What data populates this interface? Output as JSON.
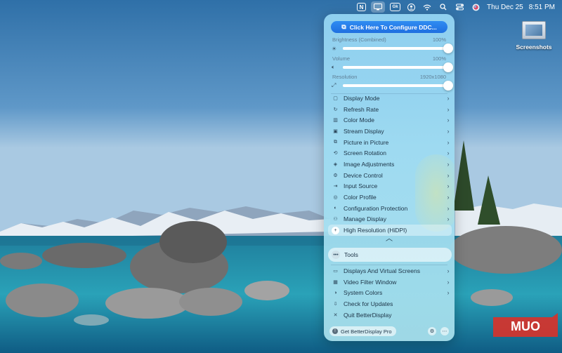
{
  "menubar": {
    "icons": [
      "notion-icon",
      "display-icon",
      "text-icon",
      "account-icon",
      "wifi-icon",
      "search-icon",
      "control-center-icon",
      "siri-icon"
    ],
    "notion_letter": "N",
    "text_icon_label": "Gk",
    "date": "Thu Dec 25",
    "time": "8:51 PM"
  },
  "desktop": {
    "icon_label": "Screenshots"
  },
  "panel": {
    "configure_button": "Click Here To Configure DDC...",
    "sliders": [
      {
        "label": "Brightness (Combined)",
        "value_text": "100%",
        "value": 1.0,
        "icon": "sun-icon"
      },
      {
        "label": "Volume",
        "value_text": "100%",
        "value": 1.0,
        "icon": "speaker-icon"
      },
      {
        "label": "Resolution",
        "value_text": "1920x1080",
        "value": 1.0,
        "icon": "resolution-icon"
      }
    ],
    "menu_items": [
      {
        "label": "Display Mode",
        "icon": "display-mode-icon",
        "submenu": true
      },
      {
        "label": "Refresh Rate",
        "icon": "refresh-rate-icon",
        "submenu": true
      },
      {
        "label": "Color Mode",
        "icon": "color-mode-icon",
        "submenu": true
      },
      {
        "label": "Stream Display",
        "icon": "stream-display-icon",
        "submenu": true
      },
      {
        "label": "Picture in Picture",
        "icon": "picture-in-picture-icon",
        "submenu": true
      },
      {
        "label": "Screen Rotation",
        "icon": "screen-rotation-icon",
        "submenu": true
      },
      {
        "label": "Image Adjustments",
        "icon": "image-adjustments-icon",
        "submenu": true
      },
      {
        "label": "Device Control",
        "icon": "device-control-icon",
        "submenu": true
      },
      {
        "label": "Input Source",
        "icon": "input-source-icon",
        "submenu": true
      },
      {
        "label": "Color Profile",
        "icon": "color-profile-icon",
        "submenu": true
      },
      {
        "label": "Configuration Protection",
        "icon": "configuration-protection-icon",
        "submenu": true
      },
      {
        "label": "Manage Display",
        "icon": "manage-display-icon",
        "submenu": true
      },
      {
        "label": "High Resolution (HiDPI)",
        "icon": "hidpi-icon",
        "submenu": false
      }
    ],
    "tools_label": "Tools",
    "bottom_items": [
      {
        "label": "Displays And Virtual Screens",
        "icon": "virtual-screens-icon",
        "submenu": true
      },
      {
        "label": "Video Filter Window",
        "icon": "video-filter-icon",
        "submenu": true
      },
      {
        "label": "System Colors",
        "icon": "system-colors-icon",
        "submenu": true
      },
      {
        "label": "Check for Updates",
        "icon": "check-updates-icon",
        "submenu": false
      },
      {
        "label": "Quit BetterDisplay",
        "icon": "quit-icon",
        "submenu": false
      }
    ],
    "pro_button": "Get BetterDisplay Pro"
  },
  "watermark": "MUO",
  "colors": {
    "accent": "#2f8cf2",
    "panel_tint": "#9ed8f2",
    "watermark_red": "#d6332b"
  }
}
